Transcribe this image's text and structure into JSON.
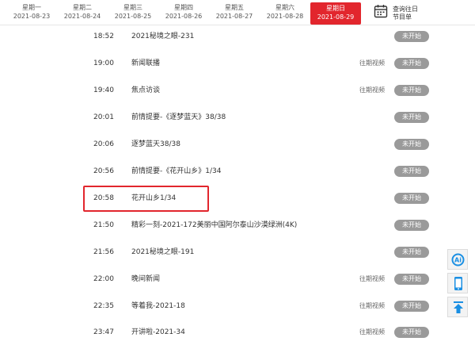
{
  "days": [
    {
      "weekday": "星期一",
      "date": "2021-08-23",
      "active": false
    },
    {
      "weekday": "星期二",
      "date": "2021-08-24",
      "active": false
    },
    {
      "weekday": "星期三",
      "date": "2021-08-25",
      "active": false
    },
    {
      "weekday": "星期四",
      "date": "2021-08-26",
      "active": false
    },
    {
      "weekday": "星期五",
      "date": "2021-08-27",
      "active": false
    },
    {
      "weekday": "星期六",
      "date": "2021-08-28",
      "active": false
    },
    {
      "weekday": "星期日",
      "date": "2021-08-29",
      "active": true
    }
  ],
  "history": {
    "line1": "查询往日",
    "line2": "节目单"
  },
  "programs": [
    {
      "time": "18:52",
      "title": "2021秘境之眼-231",
      "replay": "",
      "status": "未开始"
    },
    {
      "time": "19:00",
      "title": "新闻联播",
      "replay": "往期视频",
      "status": "未开始"
    },
    {
      "time": "19:40",
      "title": "焦点访谈",
      "replay": "往期视频",
      "status": "未开始"
    },
    {
      "time": "20:01",
      "title": "前情提要-《逐梦蓝天》38/38",
      "replay": "",
      "status": "未开始"
    },
    {
      "time": "20:06",
      "title": "逐梦蓝天38/38",
      "replay": "",
      "status": "未开始"
    },
    {
      "time": "20:56",
      "title": "前情提要-《花开山乡》1/34",
      "replay": "",
      "status": "未开始"
    },
    {
      "time": "20:58",
      "title": "花开山乡1/34",
      "replay": "",
      "status": "未开始"
    },
    {
      "time": "21:50",
      "title": "精彩一刻-2021-172美丽中国阿尔泰山沙漠绿洲(4K)",
      "replay": "",
      "status": "未开始"
    },
    {
      "time": "21:56",
      "title": "2021秘境之眼-191",
      "replay": "",
      "status": "未开始"
    },
    {
      "time": "22:00",
      "title": "晚间新闻",
      "replay": "往期视频",
      "status": "未开始"
    },
    {
      "time": "22:35",
      "title": "等着我-2021-18",
      "replay": "往期视频",
      "status": "未开始"
    },
    {
      "time": "23:47",
      "title": "开讲啦-2021-34",
      "replay": "往期视频",
      "status": "未开始"
    }
  ],
  "colors": {
    "accent": "#e2262d",
    "status_bg": "#9a9a9a",
    "side_icon": "#1a8fe3"
  },
  "side_icons": [
    "ai-icon",
    "mobile-icon",
    "back-to-top-icon"
  ]
}
